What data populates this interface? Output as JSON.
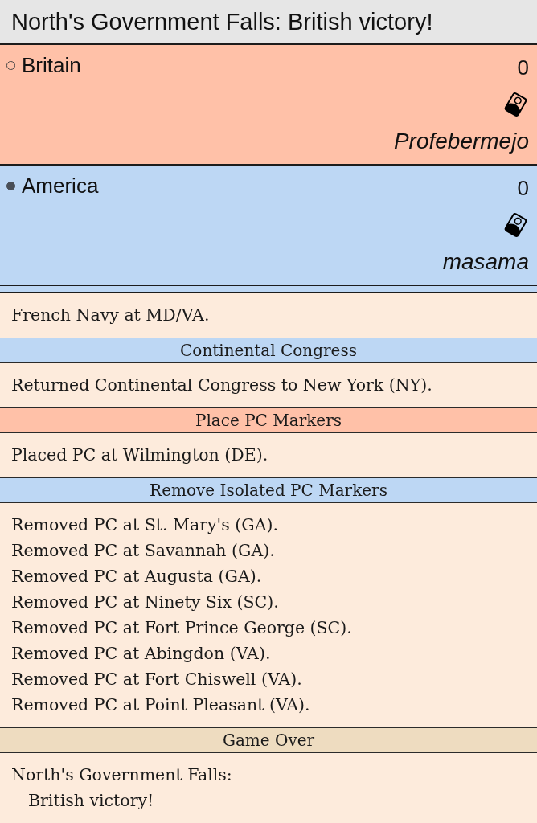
{
  "title": "North's Government Falls: British victory!",
  "players": [
    {
      "name": "Britain",
      "active": false,
      "score": "0",
      "user": "Profebermejo",
      "color": "#ffc1a8"
    },
    {
      "name": "America",
      "active": true,
      "score": "0",
      "user": "masama",
      "color": "#bdd7f4"
    }
  ],
  "log": [
    {
      "kind": "strip",
      "color": "#bdd7f4"
    },
    {
      "kind": "entry",
      "lines": [
        "French Navy at MD/VA."
      ]
    },
    {
      "kind": "header",
      "text": "Continental Congress",
      "color": "#bdd7f4"
    },
    {
      "kind": "entry",
      "lines": [
        "Returned Continental Congress to New York (NY)."
      ]
    },
    {
      "kind": "header",
      "text": "Place PC Markers",
      "color": "#ffc1a8"
    },
    {
      "kind": "entry",
      "lines": [
        "Placed PC at Wilmington (DE)."
      ]
    },
    {
      "kind": "header",
      "text": "Remove Isolated PC Markers",
      "color": "#bdd7f4"
    },
    {
      "kind": "entry",
      "lines": [
        "Removed PC at St. Mary's (GA).",
        "Removed PC at Savannah (GA).",
        "Removed PC at Augusta (GA).",
        "Removed PC at Ninety Six (SC).",
        "Removed PC at Fort Prince George (SC).",
        "Removed PC at Abingdon (VA).",
        "Removed PC at Fort Chiswell (VA).",
        "Removed PC at Point Pleasant (VA)."
      ]
    },
    {
      "kind": "header",
      "text": "Game Over",
      "color": "#eedcc0"
    },
    {
      "kind": "entry",
      "lines": [
        "North's Government Falls:\nBritish victory!"
      ]
    }
  ]
}
